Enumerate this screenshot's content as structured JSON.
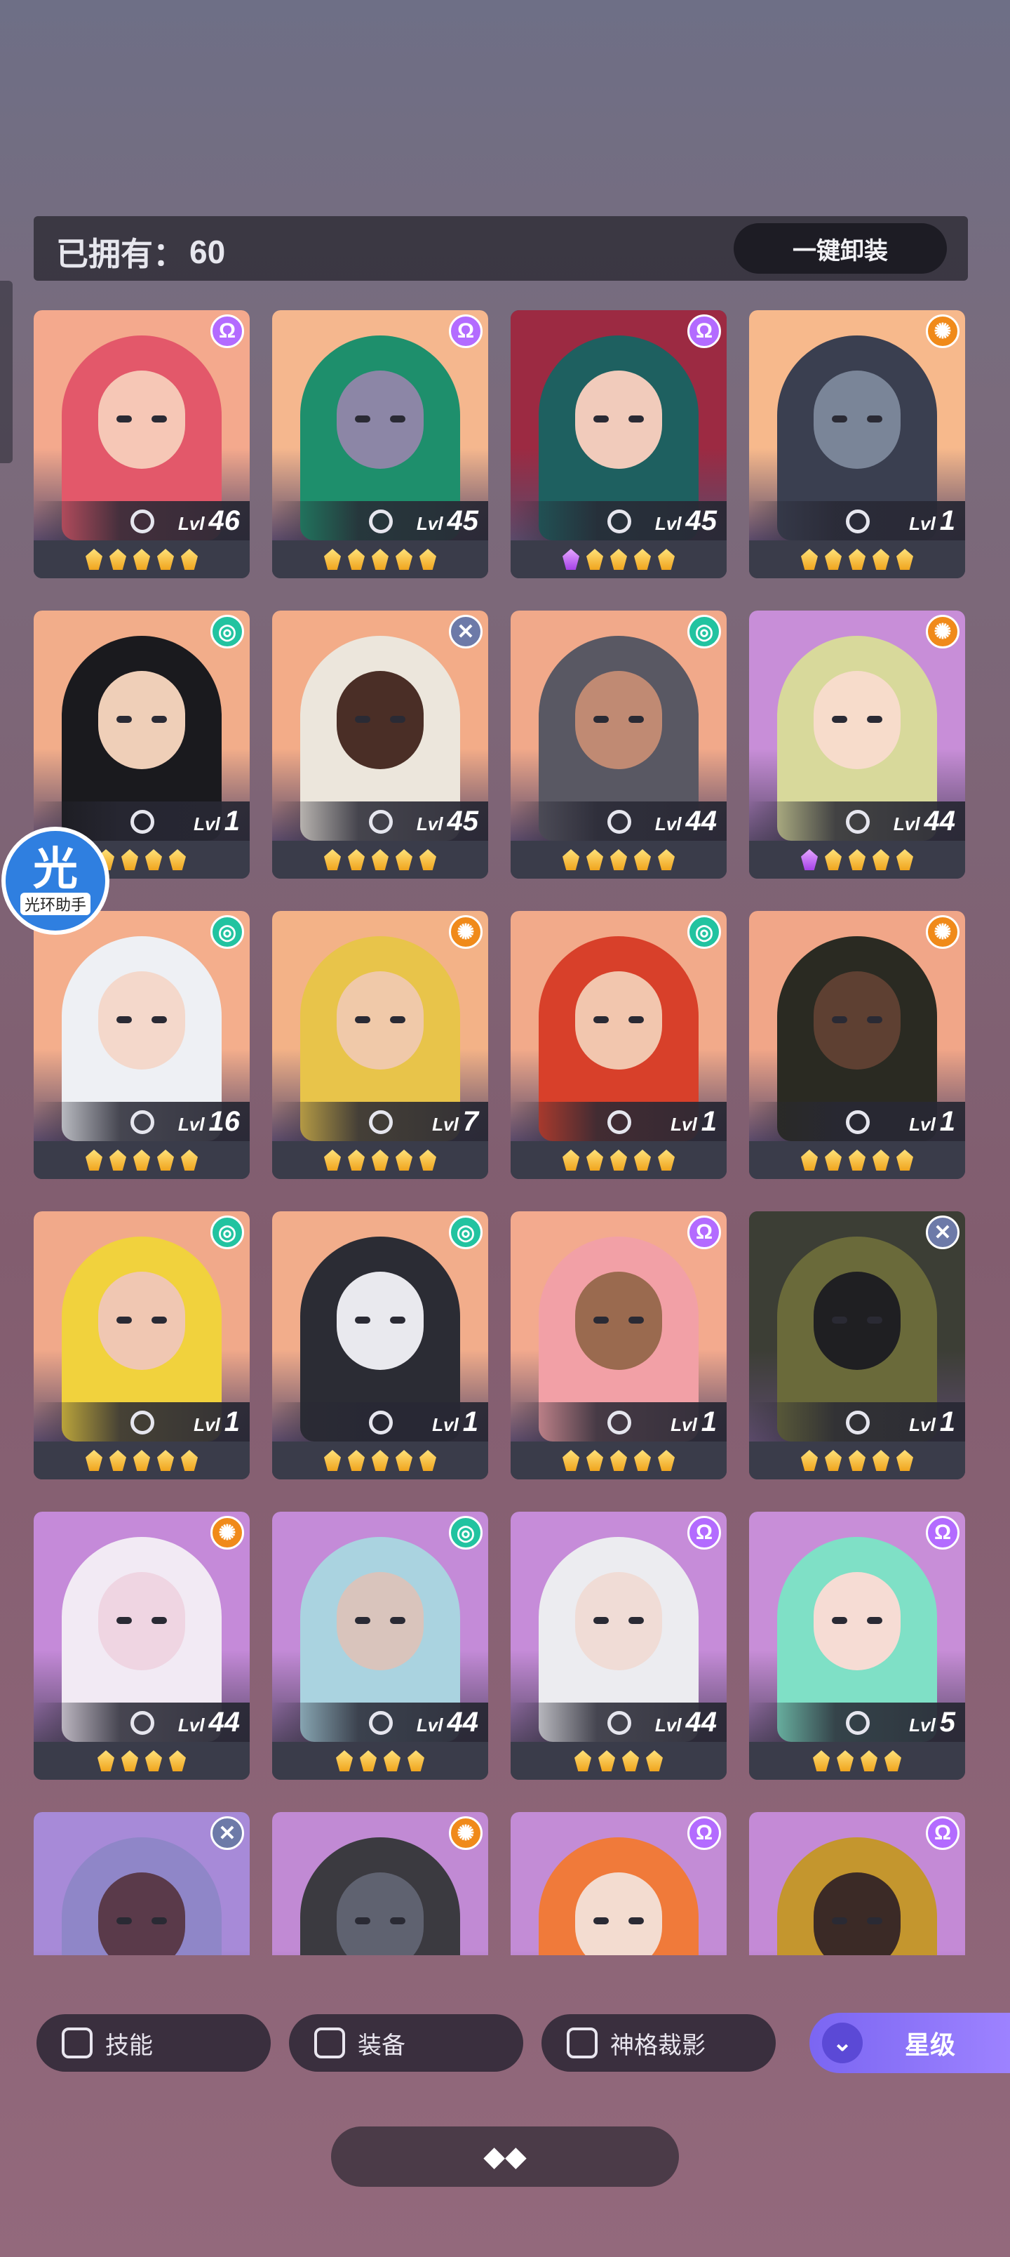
{
  "header": {
    "owned_label": "已拥有：",
    "owned_count": "60",
    "unequip_button": "一键卸装"
  },
  "colors": {
    "accent_purple": "#8b74f8",
    "star_gold": "#f5b92a",
    "star_purple": "#c77cf4",
    "card_bg": "#3a3c4a"
  },
  "heroes": [
    {
      "element": "omega",
      "element_color": "#b36bff",
      "level_prefix": "Lvl",
      "level": "46",
      "stars": [
        "gold",
        "gold",
        "gold",
        "gold",
        "gold"
      ],
      "bg": "#f4a98d",
      "skin": "#f6c7b6",
      "hair": "#e3586a"
    },
    {
      "element": "omega",
      "element_color": "#b36bff",
      "level_prefix": "Lvl",
      "level": "45",
      "stars": [
        "gold",
        "gold",
        "gold",
        "gold",
        "gold"
      ],
      "bg": "#f5b78e",
      "skin": "#8c86a6",
      "hair": "#1e8f6c"
    },
    {
      "element": "omega",
      "element_color": "#b36bff",
      "level_prefix": "Lvl",
      "level": "45",
      "stars": [
        "purple",
        "gold",
        "gold",
        "gold",
        "gold"
      ],
      "bg": "#9c2a42",
      "skin": "#f1cbbb",
      "hair": "#1e6060"
    },
    {
      "element": "sun",
      "element_color": "#f08a1a",
      "level_prefix": "Lvl",
      "level": "1",
      "stars": [
        "gold",
        "gold",
        "gold",
        "gold",
        "gold"
      ],
      "bg": "#f7b98c",
      "skin": "#7a8598",
      "hair": "#3a3f50"
    },
    {
      "element": "spiral",
      "element_color": "#22c3a0",
      "level_prefix": "Lvl",
      "level": "1",
      "stars": [
        "gold",
        "gold",
        "gold",
        "gold"
      ],
      "bg": "#f2ad8a",
      "skin": "#efcfb8",
      "hair": "#1a1a1e"
    },
    {
      "element": "cross",
      "element_color": "#6d7aa8",
      "level_prefix": "Lvl",
      "level": "45",
      "stars": [
        "gold",
        "gold",
        "gold",
        "gold",
        "gold"
      ],
      "bg": "#f3ac88",
      "skin": "#4a2e26",
      "hair": "#ece6dc"
    },
    {
      "element": "spiral",
      "element_color": "#22c3a0",
      "level_prefix": "Lvl",
      "level": "44",
      "stars": [
        "gold",
        "gold",
        "gold",
        "gold",
        "gold"
      ],
      "bg": "#f1a98a",
      "skin": "#c08a73",
      "hair": "#595863"
    },
    {
      "element": "sun",
      "element_color": "#f08a1a",
      "level_prefix": "Lvl",
      "level": "44",
      "stars": [
        "purple",
        "gold",
        "gold",
        "gold",
        "gold"
      ],
      "bg": "#c88ed8",
      "skin": "#f7dccb",
      "hair": "#d8d99b"
    },
    {
      "element": "spiral",
      "element_color": "#22c3a0",
      "level_prefix": "Lvl",
      "level": "16",
      "stars": [
        "gold",
        "gold",
        "gold",
        "gold",
        "gold"
      ],
      "bg": "#f4ae8c",
      "skin": "#f4d8cb",
      "hair": "#eef0f4"
    },
    {
      "element": "sun",
      "element_color": "#f08a1a",
      "level_prefix": "Lvl",
      "level": "7",
      "stars": [
        "gold",
        "gold",
        "gold",
        "gold",
        "gold"
      ],
      "bg": "#f3b287",
      "skin": "#f0c9a9",
      "hair": "#e8c44a"
    },
    {
      "element": "spiral",
      "element_color": "#22c3a0",
      "level_prefix": "Lvl",
      "level": "1",
      "stars": [
        "gold",
        "gold",
        "gold",
        "gold",
        "gold"
      ],
      "bg": "#f2aa8a",
      "skin": "#f2c6ae",
      "hair": "#d8402a"
    },
    {
      "element": "sun",
      "element_color": "#f08a1a",
      "level_prefix": "Lvl",
      "level": "1",
      "stars": [
        "gold",
        "gold",
        "gold",
        "gold",
        "gold"
      ],
      "bg": "#f1a688",
      "skin": "#5e4032",
      "hair": "#2a2a22"
    },
    {
      "element": "spiral",
      "element_color": "#22c3a0",
      "level_prefix": "Lvl",
      "level": "1",
      "stars": [
        "gold",
        "gold",
        "gold",
        "gold",
        "gold"
      ],
      "bg": "#f1a98a",
      "skin": "#f0c7b2",
      "hair": "#f1d23d"
    },
    {
      "element": "spiral",
      "element_color": "#22c3a0",
      "level_prefix": "Lvl",
      "level": "1",
      "stars": [
        "gold",
        "gold",
        "gold",
        "gold",
        "gold"
      ],
      "bg": "#f2ad8b",
      "skin": "#e9e9ee",
      "hair": "#2b2c34"
    },
    {
      "element": "omega",
      "element_color": "#b36bff",
      "level_prefix": "Lvl",
      "level": "1",
      "stars": [
        "gold",
        "gold",
        "gold",
        "gold",
        "gold"
      ],
      "bg": "#f3aa8e",
      "skin": "#9a6a4f",
      "hair": "#f2a0a6"
    },
    {
      "element": "cross",
      "element_color": "#6d7aa8",
      "level_prefix": "Lvl",
      "level": "1",
      "stars": [
        "gold",
        "gold",
        "gold",
        "gold",
        "gold"
      ],
      "bg": "#3c3e35",
      "skin": "#1f1f22",
      "hair": "#6a6a3a"
    },
    {
      "element": "sun",
      "element_color": "#f08a1a",
      "level_prefix": "Lvl",
      "level": "44",
      "stars": [
        "gold",
        "gold",
        "gold",
        "gold"
      ],
      "bg": "#c58ad9",
      "skin": "#efd5e2",
      "hair": "#f2eaf4"
    },
    {
      "element": "spiral",
      "element_color": "#22c3a0",
      "level_prefix": "Lvl",
      "level": "44",
      "stars": [
        "gold",
        "gold",
        "gold",
        "gold"
      ],
      "bg": "#c48bd8",
      "skin": "#d9c4bc",
      "hair": "#aad3e0"
    },
    {
      "element": "omega",
      "element_color": "#b36bff",
      "level_prefix": "Lvl",
      "level": "44",
      "stars": [
        "gold",
        "gold",
        "gold",
        "gold"
      ],
      "bg": "#c68cd9",
      "skin": "#f0dcd6",
      "hair": "#ececf0"
    },
    {
      "element": "omega",
      "element_color": "#b36bff",
      "level_prefix": "Lvl",
      "level": "5",
      "stars": [
        "gold",
        "gold",
        "gold",
        "gold"
      ],
      "bg": "#c88ed8",
      "skin": "#f6dcd4",
      "hair": "#7fe0c6"
    },
    {
      "element": "cross",
      "element_color": "#6d7aa8",
      "level_prefix": "",
      "level": "",
      "stars": [],
      "bg": "#a78ad8",
      "skin": "#5a3a4a",
      "hair": "#8f86c8"
    },
    {
      "element": "sun",
      "element_color": "#f08a1a",
      "level_prefix": "",
      "level": "",
      "stars": [],
      "bg": "#c18ad4",
      "skin": "#5f6270",
      "hair": "#3b3a40"
    },
    {
      "element": "omega",
      "element_color": "#b36bff",
      "level_prefix": "",
      "level": "",
      "stars": [],
      "bg": "#c38cd6",
      "skin": "#f3dcd0",
      "hair": "#f07a3a"
    },
    {
      "element": "omega",
      "element_color": "#b36bff",
      "level_prefix": "",
      "level": "",
      "stars": [],
      "bg": "#c48ad6",
      "skin": "#3b2a26",
      "hair": "#c4962e"
    }
  ],
  "filters": {
    "skill_label": "技能",
    "equipment_label": "装备",
    "divine_label": "神格裁影",
    "star_sort_label": "星级",
    "sort_icon": "double-chevron-down-icon"
  },
  "helper": {
    "big_glyph": "光",
    "caption": "光环助手"
  },
  "bottom": {
    "icon": "tri-diamond-icon"
  }
}
